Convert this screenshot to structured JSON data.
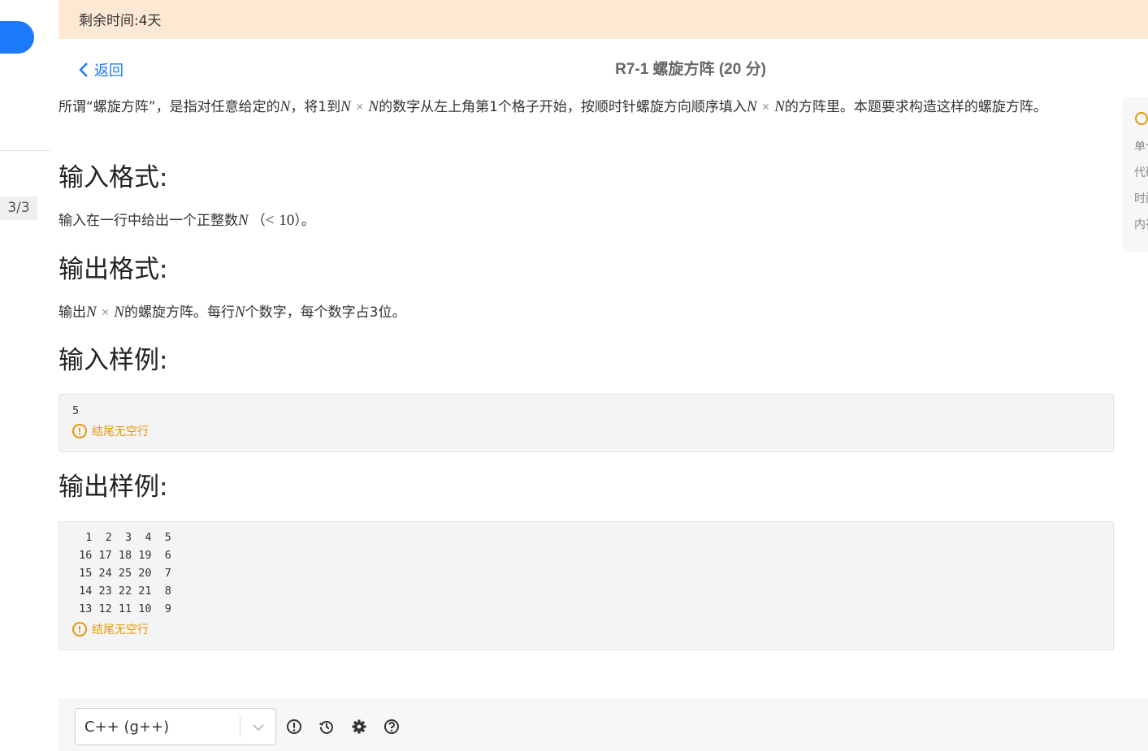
{
  "banner": {
    "remaining_time": "剩余时间:4天"
  },
  "sidebar": {
    "counter": "3/3"
  },
  "header": {
    "back_label": "返回",
    "title": "R7-1 螺旋方阵 (20 分)"
  },
  "problem": {
    "intro_1": "所谓“螺旋方阵”，是指对任意给定的",
    "var_n": "N",
    "intro_2": "，将1到",
    "times": "×",
    "intro_3": "的数字从左上角第1个格子开始，按顺时针螺旋方向顺序填入",
    "intro_4": "的方阵里。本题要求构造这样的螺旋方阵。",
    "input_heading": "输入格式:",
    "input_text_1": "输入在一行中给出一个正整数",
    "input_text_lparen": "（",
    "input_lt": "<",
    "input_ten": "10",
    "input_text_2": "）。",
    "output_heading": "输出格式:",
    "output_text_1": "输出",
    "output_text_2": "的螺旋方阵。每行",
    "output_text_3": "个数字，每个数字占3位。",
    "sample_in_heading": "输入样例:",
    "sample_in": "5",
    "sample_out_heading": "输出样例:",
    "sample_out": "  1  2  3  4  5\n 16 17 18 19  6\n 15 24 25 20  7\n 14 23 22 21  8\n 13 12 11 10  9",
    "trailing_note": "结尾无空行"
  },
  "side_panel": {
    "items": [
      "单个",
      "代码",
      "时间",
      "内存"
    ]
  },
  "editor": {
    "language": "C++ (g++)"
  }
}
